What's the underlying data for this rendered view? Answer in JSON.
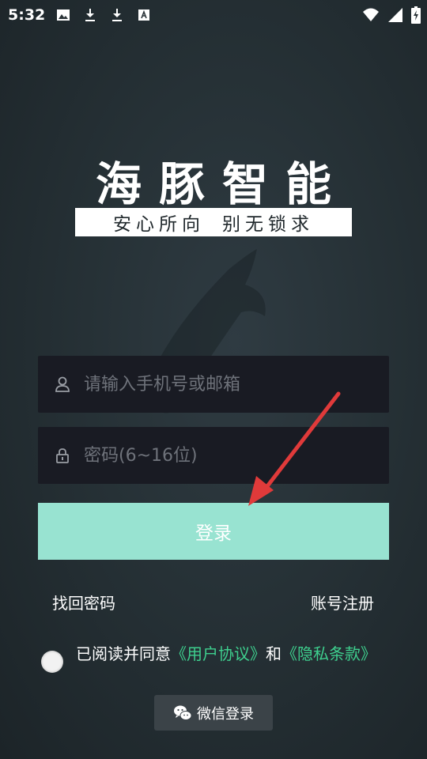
{
  "status_bar": {
    "time": "5:32",
    "icons": [
      "image-icon",
      "download-icon",
      "download-icon",
      "font-icon"
    ],
    "right_icons": [
      "wifi-icon",
      "signal-icon",
      "battery-icon"
    ]
  },
  "brand": {
    "title": "海豚智能",
    "slogan_left": "安心所向",
    "slogan_right": "别无锁求"
  },
  "form": {
    "phone_placeholder": "请输入手机号或邮箱",
    "password_placeholder": "密码(6~16位)",
    "login_label": "登录"
  },
  "links": {
    "forgot": "找回密码",
    "register": "账号注册"
  },
  "agreement": {
    "prefix": "已阅读并同意",
    "user_agreement": "《用户协议》",
    "and": "和",
    "privacy": "《隐私条款》"
  },
  "wechat": {
    "label": "微信登录"
  },
  "colors": {
    "accent": "#98e3d1",
    "link_green": "#3ecf8e",
    "field_bg": "#191b23",
    "annotation_arrow": "#e03a3a"
  }
}
